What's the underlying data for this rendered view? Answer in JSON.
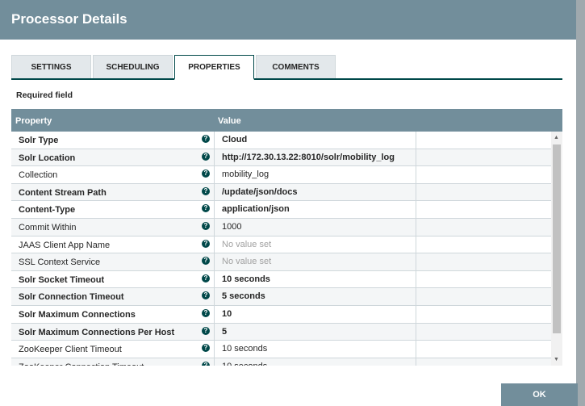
{
  "title": "Processor Details",
  "tabs": [
    "SETTINGS",
    "SCHEDULING",
    "PROPERTIES",
    "COMMENTS"
  ],
  "required_label": "Required field",
  "columns": {
    "property": "Property",
    "value": "Value"
  },
  "rows": [
    {
      "p": "Solr Type",
      "v": "Cloud",
      "bold": true
    },
    {
      "p": "Solr Location",
      "v": "http://172.30.13.22:8010/solr/mobility_log",
      "bold": true
    },
    {
      "p": "Collection",
      "v": "mobility_log"
    },
    {
      "p": "Content Stream Path",
      "v": "/update/json/docs",
      "bold": true
    },
    {
      "p": "Content-Type",
      "v": "application/json",
      "bold": true
    },
    {
      "p": "Commit Within",
      "v": "1000"
    },
    {
      "p": "JAAS Client App Name",
      "v": "No value set",
      "nv": true
    },
    {
      "p": "SSL Context Service",
      "v": "No value set",
      "nv": true
    },
    {
      "p": "Solr Socket Timeout",
      "v": "10 seconds",
      "bold": true
    },
    {
      "p": "Solr Connection Timeout",
      "v": "5 seconds",
      "bold": true
    },
    {
      "p": "Solr Maximum Connections",
      "v": "10",
      "bold": true
    },
    {
      "p": "Solr Maximum Connections Per Host",
      "v": "5",
      "bold": true
    },
    {
      "p": "ZooKeeper Client Timeout",
      "v": "10 seconds"
    },
    {
      "p": "ZooKeeper Connection Timeout",
      "v": "10 seconds"
    }
  ],
  "help_glyph": "?",
  "ok_label": "OK"
}
